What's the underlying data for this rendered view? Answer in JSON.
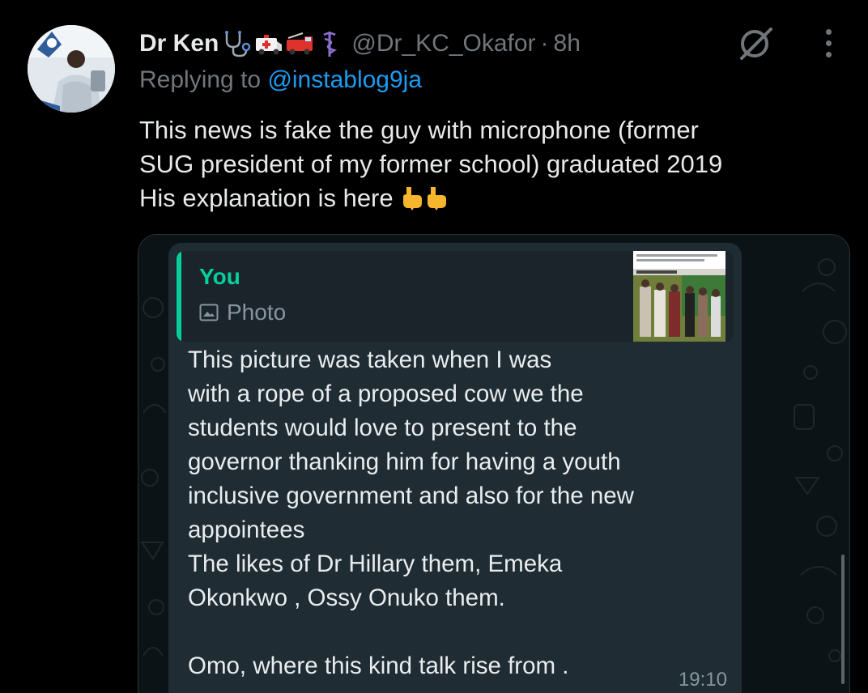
{
  "tweet": {
    "author_name": "Dr Ken",
    "author_emojis": [
      "stethoscope-icon",
      "ambulance-icon",
      "fire-engine-icon",
      "medical-symbol-icon"
    ],
    "handle": "@Dr_KC_Okafor",
    "separator": "·",
    "time": "8h",
    "replying_prefix": "Replying to",
    "replying_to": "@instablog9ja",
    "text_lines": [
      "This news is fake the guy with microphone (former",
      "SUG president of my former school) graduated 2019",
      "His explanation is here"
    ],
    "text_end_emojis": [
      "pointing-down-hand-icon",
      "pointing-down-hand-icon"
    ]
  },
  "chat_screenshot": {
    "quote_author": "You",
    "quote_type": "Photo",
    "message_lines": [
      "This picture was taken when I was",
      "with a rope of a proposed cow we the",
      "students would love to present to the",
      "governor thanking him for having a youth",
      "inclusive government and also for the new",
      "appointees",
      "The likes of Dr Hillary them, Emeka",
      "Okonkwo , Ossy Onuko them.",
      "",
      "Omo, where this kind talk rise from ."
    ],
    "timestamp": "19:10"
  },
  "colors": {
    "background": "#000000",
    "text_primary": "#e7e9ea",
    "text_secondary": "#71767b",
    "link": "#1d9bf0",
    "chat_bubble": "#1f2c33",
    "quote_accent": "#06cf9c"
  }
}
